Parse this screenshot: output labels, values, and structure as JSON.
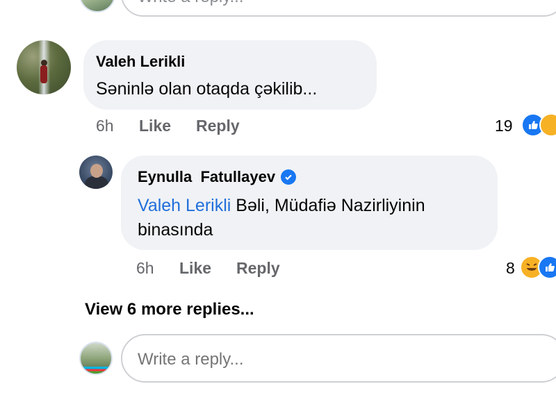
{
  "top_reply": {
    "placeholder": "Write a reply..."
  },
  "comment": {
    "author": "Valeh Lerikli",
    "text": "Səninlə olan otaqda çəkilib...",
    "time": "6h",
    "like_label": "Like",
    "reply_label": "Reply",
    "reaction_count": "19",
    "reactions": [
      "like-icon",
      "care-emoji-icon"
    ]
  },
  "reply": {
    "author": "Eynulla  Fatullayev",
    "verified": true,
    "mention": "Valeh Lerikli",
    "text_line1": " Bəli, Müdafiə Nazirliyinin",
    "text_line2": "binasında",
    "time": "6h",
    "like_label": "Like",
    "reply_label": "Reply",
    "reaction_count": "8",
    "reactions": [
      "haha-emoji-icon",
      "like-icon"
    ]
  },
  "view_more": "View 6 more replies...",
  "bottom_reply": {
    "placeholder": "Write a reply..."
  },
  "colors": {
    "bubble": "#f0f2f5",
    "link": "#216fdb",
    "like_blue": "#1877f2",
    "meta_gray": "#65676b"
  }
}
